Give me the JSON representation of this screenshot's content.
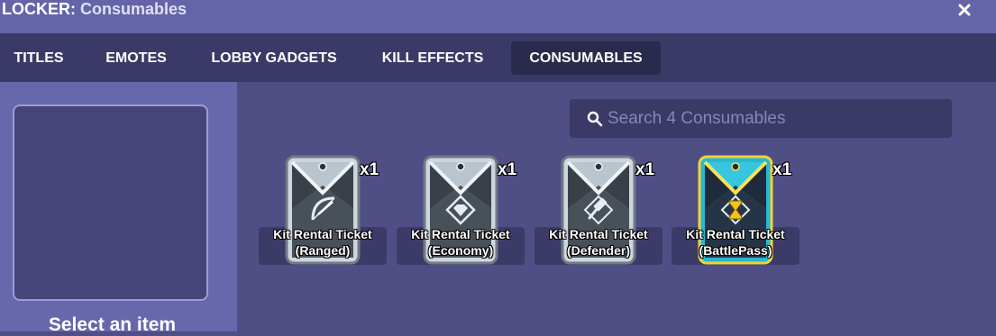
{
  "window": {
    "title_prefix": "LOCKER:",
    "title_section": "Consumables",
    "close_label": "✕"
  },
  "tabs": [
    {
      "label": "TITLES",
      "active": false
    },
    {
      "label": "EMOTES",
      "active": false
    },
    {
      "label": "LOBBY GADGETS",
      "active": false
    },
    {
      "label": "KILL EFFECTS",
      "active": false
    },
    {
      "label": "CONSUMABLES",
      "active": true
    }
  ],
  "preview": {
    "hint": "Select an item"
  },
  "search": {
    "placeholder": "Search 4 Consumables",
    "value": "",
    "icon": "search-icon"
  },
  "items": [
    {
      "name_line1": "Kit Rental Ticket",
      "name_line2": "(Ranged)",
      "quantity": "x1",
      "icon": "bow-icon",
      "tier": "silver"
    },
    {
      "name_line1": "Kit Rental Ticket",
      "name_line2": "(Economy)",
      "quantity": "x1",
      "icon": "diamond-icon",
      "tier": "silver"
    },
    {
      "name_line1": "Kit Rental Ticket",
      "name_line2": "(Defender)",
      "quantity": "x1",
      "icon": "hammer-icon",
      "tier": "silver"
    },
    {
      "name_line1": "Kit Rental Ticket",
      "name_line2": "(BattlePass)",
      "quantity": "x1",
      "icon": "hourglass-icon",
      "tier": "gold"
    }
  ],
  "colors": {
    "background": "#4f4e85",
    "titlebar": "#6464a8",
    "tabbar": "#3b3a66",
    "active_tab": "#2a2a4c",
    "left_panel": "#6767ab",
    "ticket_silver": "#cdd6dd",
    "ticket_gold_border": "#f2d23a",
    "ticket_gold_fill": "#2bb7cf"
  }
}
